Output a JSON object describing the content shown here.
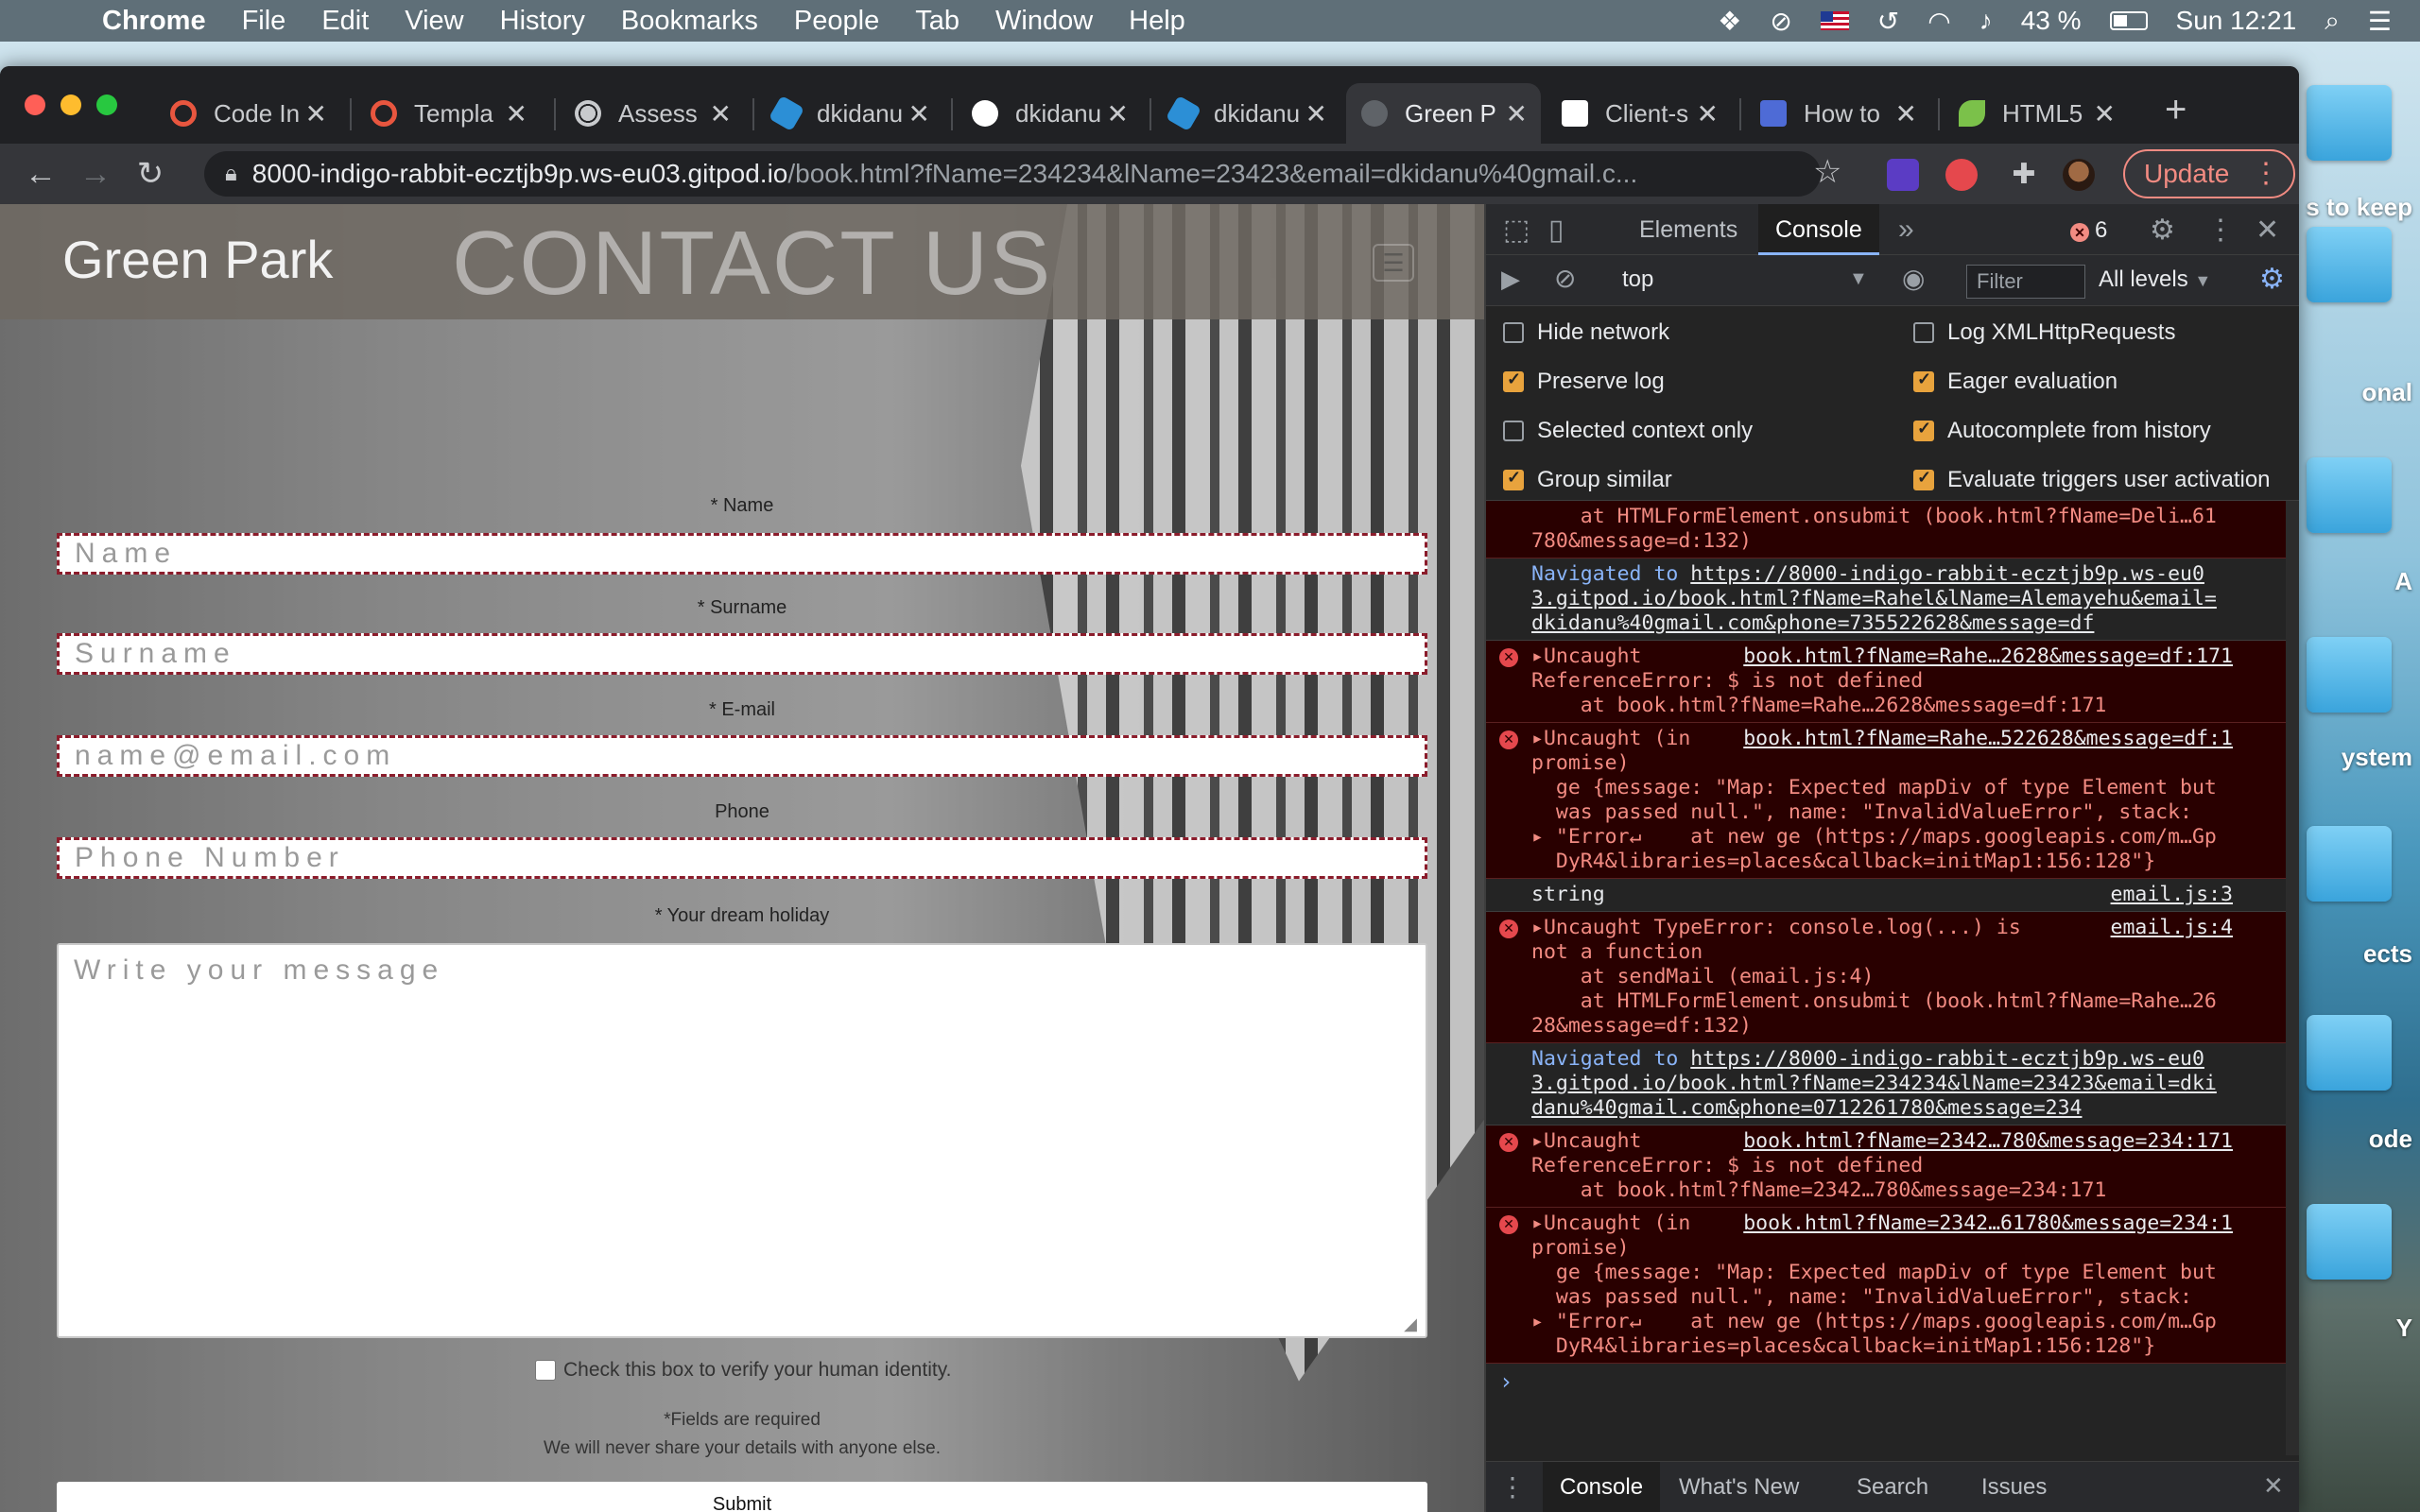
{
  "menubar": {
    "app": "Chrome",
    "items": [
      "File",
      "Edit",
      "View",
      "History",
      "Bookmarks",
      "People",
      "Tab",
      "Window",
      "Help"
    ],
    "battery": "43 %",
    "clock": "Sun 12:21"
  },
  "desktop": {
    "labels": [
      "s to keep",
      "onal",
      "A",
      "ystem",
      "ects",
      "ode",
      "Y"
    ]
  },
  "tabs": [
    {
      "label": "Code In",
      "color": "#e8563f"
    },
    {
      "label": "Templa",
      "color": "#e8563f"
    },
    {
      "label": "Assess",
      "color": "#c8cacd"
    },
    {
      "label": "dkidanu",
      "color": "#2c8fd6"
    },
    {
      "label": "dkidanu",
      "color": "#ffffff"
    },
    {
      "label": "dkidanu",
      "color": "#2c8fd6"
    },
    {
      "label": "Green P",
      "color": "#5f6368"
    },
    {
      "label": "Client-s",
      "color": "#ffffff"
    },
    {
      "label": "How to",
      "color": "#4e6bd6"
    },
    {
      "label": "HTML5",
      "color": "#7bc14a"
    }
  ],
  "omnibox": {
    "host": "8000-indigo-rabbit-ecztjb9p.ws-eu03.gitpod.io",
    "path": "/book.html?fName=234234&lName=23423&email=dkidanu%40gmail.c..."
  },
  "update_label": "Update",
  "page": {
    "brand": "Green Park",
    "hero_title": "CONTACT US",
    "fields": [
      {
        "label": "* Name",
        "placeholder": "Name"
      },
      {
        "label": "* Surname",
        "placeholder": "Surname"
      },
      {
        "label": "* E-mail",
        "placeholder": "name@email.com"
      },
      {
        "label": "Phone",
        "placeholder": "Phone Number"
      }
    ],
    "message_label": "* Your dream holiday",
    "message_placeholder": "Write your message",
    "checkbox_label": "Check this box to verify your human identity.",
    "required_note": "*Fields are required",
    "privacy_note": "We will never share your details with anyone else.",
    "submit_label": "Submit"
  },
  "devtools": {
    "tabs": [
      "Elements",
      "Console"
    ],
    "error_count": "6",
    "context": "top",
    "filter_placeholder": "Filter",
    "levels": "All levels",
    "settings": [
      {
        "label": "Hide network",
        "checked": false
      },
      {
        "label": "Log XMLHttpRequests",
        "checked": false
      },
      {
        "label": "Preserve log",
        "checked": true
      },
      {
        "label": "Eager evaluation",
        "checked": true
      },
      {
        "label": "Selected context only",
        "checked": false
      },
      {
        "label": "Autocomplete from history",
        "checked": true
      },
      {
        "label": "Group similar",
        "checked": true
      },
      {
        "label": "Evaluate triggers user activation",
        "checked": true
      }
    ],
    "drawer_tabs": [
      "Console",
      "What's New",
      "Search",
      "Issues"
    ],
    "console": [
      {
        "type": "err-cont",
        "lines": [
          "    at HTMLFormElement.onsubmit (book.html?fName=Deli…61",
          "780&message=d:132)"
        ]
      },
      {
        "type": "nav",
        "prefix": "Navigated to ",
        "lines": [
          "https://8000-indigo-rabbit-ecztjb9p.ws-eu0",
          "3.gitpod.io/book.html?fName=Rahel&lName=Alemayehu&email=",
          "dkidanu%40gmail.com&phone=735522628&message=df"
        ]
      },
      {
        "type": "err",
        "src": "book.html?fName=Rahe…2628&message=df:171",
        "lines": [
          "▸Uncaught",
          "ReferenceError: $ is not defined",
          "    at book.html?fName=Rahe…2628&message=df:171"
        ]
      },
      {
        "type": "err",
        "src": "book.html?fName=Rahe…522628&message=df:1",
        "lines": [
          "▸Uncaught (in",
          "promise)",
          "  ge {message: \"Map: Expected mapDiv of type Element but",
          "  was passed null.\", name: \"InvalidValueError\", stack:",
          "▸ \"Error↵    at new ge (https://maps.googleapis.com/m…Gp",
          "  DyR4&libraries=places&callback=initMap1:156:128\"}"
        ]
      },
      {
        "type": "log",
        "src": "email.js:3",
        "lines": [
          "string"
        ]
      },
      {
        "type": "err",
        "src": "email.js:4",
        "lines": [
          "▸Uncaught TypeError: console.log(...) is",
          "not a function",
          "    at sendMail (email.js:4)",
          "    at HTMLFormElement.onsubmit (book.html?fName=Rahe…26",
          "28&message=df:132)"
        ]
      },
      {
        "type": "nav",
        "prefix": "Navigated to ",
        "lines": [
          "https://8000-indigo-rabbit-ecztjb9p.ws-eu0",
          "3.gitpod.io/book.html?fName=234234&lName=23423&email=dki",
          "danu%40gmail.com&phone=0712261780&message=234"
        ]
      },
      {
        "type": "err",
        "src": "book.html?fName=2342…780&message=234:171",
        "lines": [
          "▸Uncaught",
          "ReferenceError: $ is not defined",
          "    at book.html?fName=2342…780&message=234:171"
        ]
      },
      {
        "type": "err",
        "src": "book.html?fName=2342…61780&message=234:1",
        "lines": [
          "▸Uncaught (in",
          "promise)",
          "  ge {message: \"Map: Expected mapDiv of type Element but",
          "  was passed null.\", name: \"InvalidValueError\", stack:",
          "▸ \"Error↵    at new ge (https://maps.googleapis.com/m…Gp",
          "  DyR4&libraries=places&callback=initMap1:156:128\"}"
        ]
      }
    ]
  }
}
